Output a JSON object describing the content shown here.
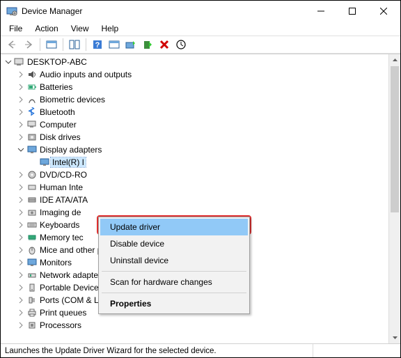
{
  "window": {
    "title": "Device Manager"
  },
  "menu": {
    "file": "File",
    "action": "Action",
    "view": "View",
    "help": "Help"
  },
  "tree": {
    "root": "DESKTOP-ABC",
    "items": [
      "Audio inputs and outputs",
      "Batteries",
      "Biometric devices",
      "Bluetooth",
      "Computer",
      "Disk drives",
      "Display adapters",
      "Intel(R) I",
      "DVD/CD-RO",
      "Human Inte",
      "IDE ATA/ATA",
      "Imaging de",
      "Keyboards",
      "Memory tec",
      "Mice and other pointing devices",
      "Monitors",
      "Network adapters",
      "Portable Devices",
      "Ports (COM & LPT)",
      "Print queues",
      "Processors"
    ]
  },
  "context_menu": {
    "update": "Update driver",
    "disable": "Disable device",
    "uninstall": "Uninstall device",
    "scan": "Scan for hardware changes",
    "properties": "Properties"
  },
  "statusbar": "Launches the Update Driver Wizard for the selected device."
}
